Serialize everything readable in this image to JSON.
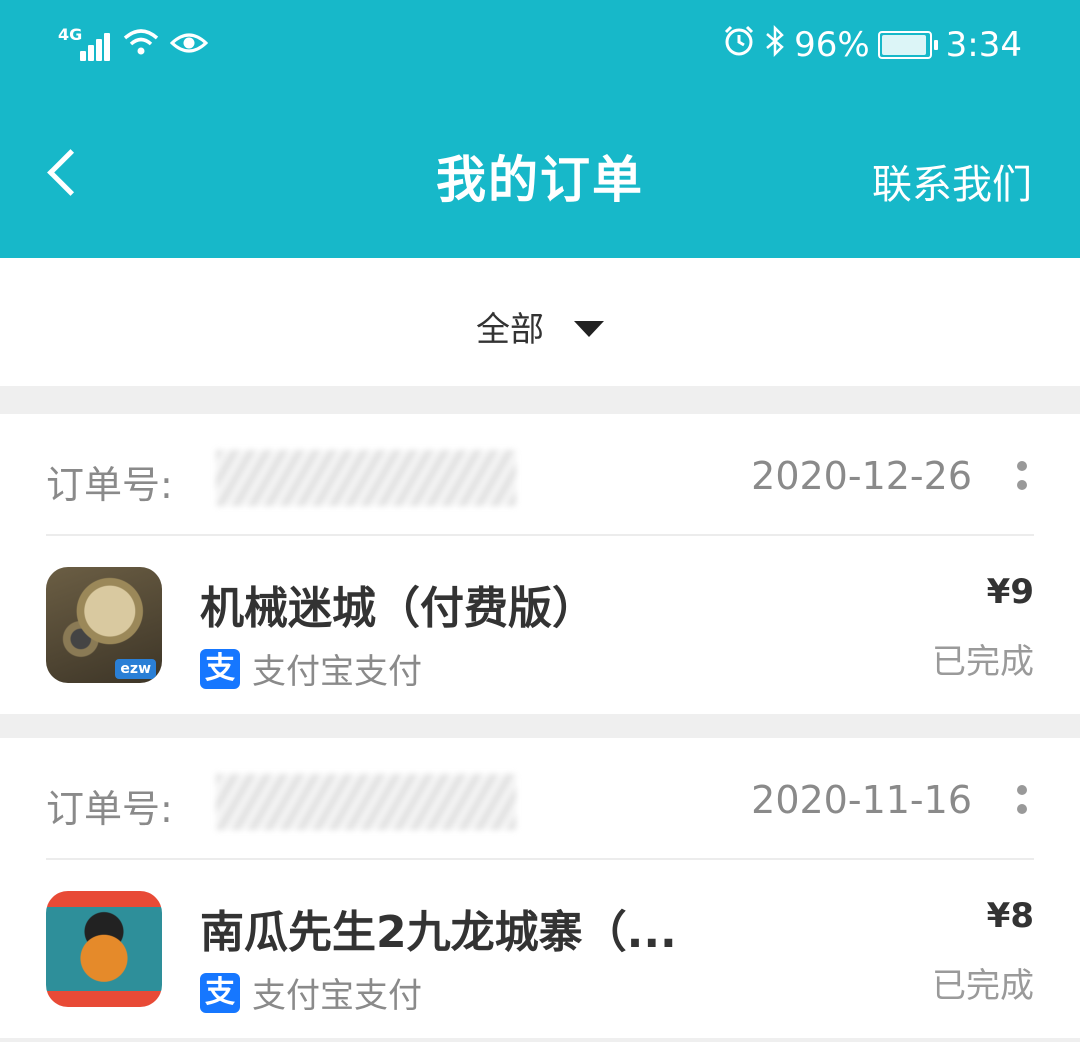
{
  "status_bar": {
    "network": "4G",
    "battery_text": "96%",
    "battery_level": 0.96,
    "time": "3:34",
    "icons": [
      "signal-icon",
      "wifi-icon",
      "eye-icon",
      "alarm-icon",
      "bluetooth-icon",
      "battery-icon"
    ]
  },
  "header": {
    "title": "我的订单",
    "contact_label": "联系我们",
    "background_color": "#17b8c9"
  },
  "filter": {
    "selected": "全部"
  },
  "orders": [
    {
      "order_label": "订单号:",
      "date": "2020-12-26",
      "app_name": "机械迷城（付费版）",
      "payment_icon_text": "支",
      "payment_method": "支付宝支付",
      "price": "¥9",
      "status": "已完成",
      "icon_badge": "ezw"
    },
    {
      "order_label": "订单号:",
      "date": "2020-11-16",
      "app_name": "南瓜先生2九龙城寨（...",
      "payment_icon_text": "支",
      "payment_method": "支付宝支付",
      "price": "¥8",
      "status": "已完成"
    }
  ]
}
